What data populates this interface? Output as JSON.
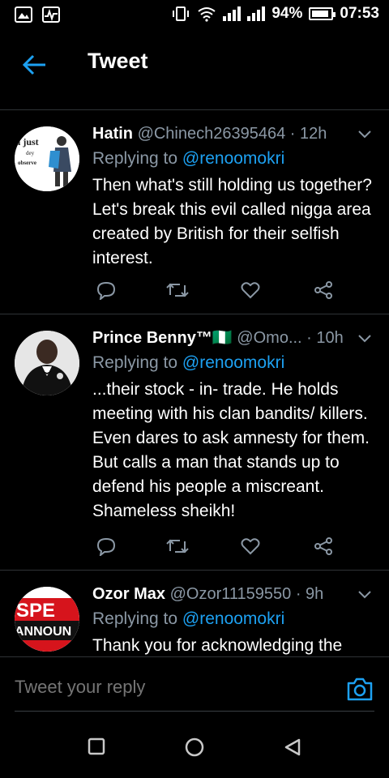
{
  "status_bar": {
    "battery_percent": "94%",
    "time": "07:53"
  },
  "app_bar": {
    "title": "Tweet"
  },
  "tweets": [
    {
      "name": "Hatin",
      "handle": "@Chinech26395464",
      "time": "· 12h",
      "replying_prefix": "Replying to",
      "replying_to": "@renoomokri",
      "text": "Then what's still holding us together? Let's break this evil called nigga area  created by British for their selfish interest.",
      "avatar_text": [
        "i just",
        "dey",
        "observe"
      ]
    },
    {
      "name": "Prince Benny™🇳🇬",
      "handle": "@Omo...",
      "time": "· 10h",
      "replying_prefix": "Replying to",
      "replying_to": "@renoomokri",
      "text": "...their stock - in- trade. He holds meeting with his clan bandits/ killers. Even dares to ask amnesty for them. But calls a man that stands up to defend his people a miscreant. Shameless sheikh!"
    },
    {
      "name": "Ozor Max",
      "handle": "@Ozor11159550",
      "time": "· 9h",
      "replying_prefix": "Replying to",
      "replying_to": "@renoomokri",
      "text": "Thank you for acknowledging the",
      "avatar_text": [
        "SPE",
        "ANNOUN"
      ]
    }
  ],
  "composer": {
    "placeholder": "Tweet your reply"
  },
  "colors": {
    "background": "#000000",
    "accent": "#1da1f2",
    "secondary_text": "#8b98a5",
    "divider": "#2f3336"
  },
  "icons": [
    "image-icon",
    "activity-icon",
    "vibrate-icon",
    "wifi-icon",
    "signal-icon",
    "battery-icon",
    "back-arrow-icon",
    "chevron-down-icon",
    "reply-icon",
    "retweet-icon",
    "like-icon",
    "share-icon",
    "camera-icon",
    "recents-icon",
    "home-icon",
    "back-triangle-icon"
  ]
}
